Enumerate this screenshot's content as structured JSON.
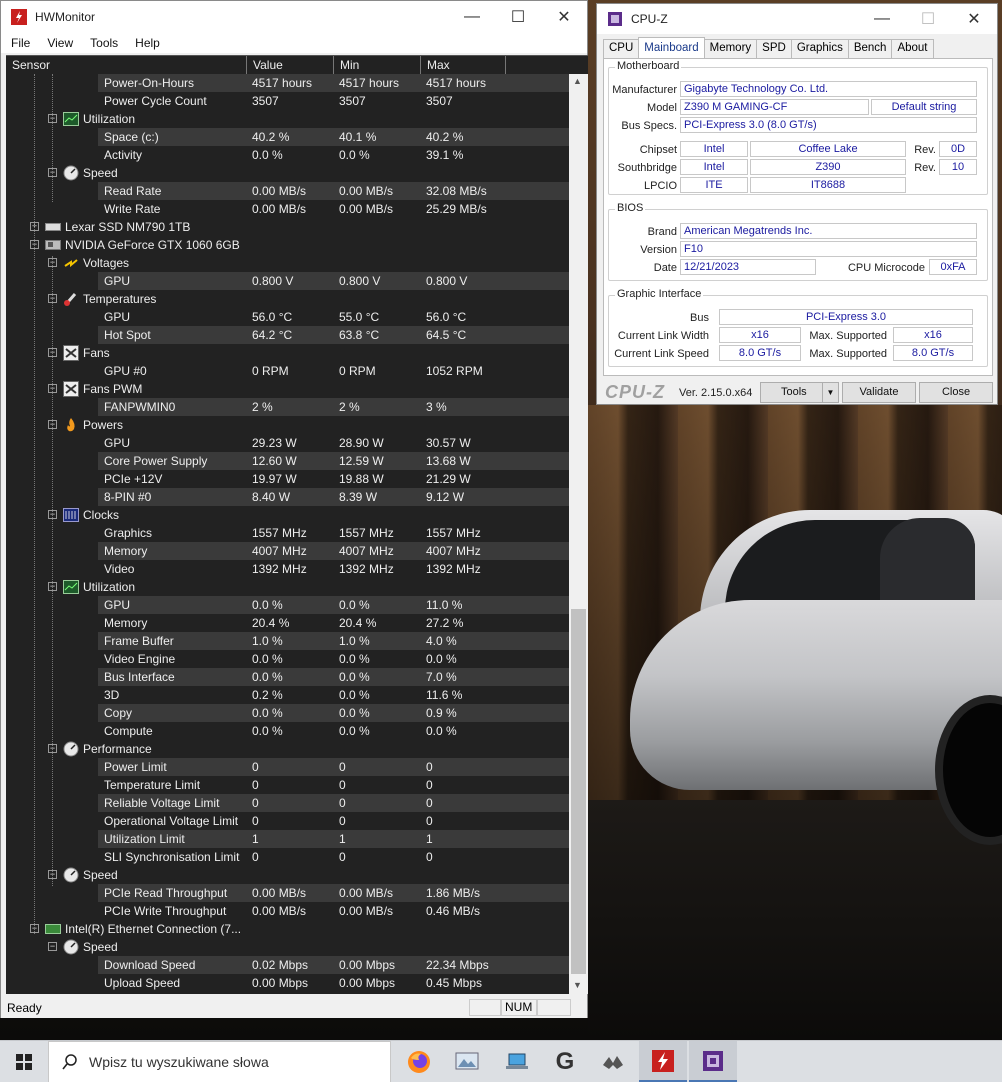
{
  "hwmonitor": {
    "title": "HWMonitor",
    "menu": [
      "File",
      "View",
      "Tools",
      "Help"
    ],
    "columns": [
      "Sensor",
      "Value",
      "Min",
      "Max"
    ],
    "status": "Ready",
    "status_num": "NUM",
    "devices": {
      "lexar": "Lexar SSD NM790 1TB",
      "nvidia": "NVIDIA GeForce GTX 1060 6GB",
      "intel": "Intel(R) Ethernet Connection (7..."
    },
    "groups": {
      "util1": "Utilization",
      "speed1": "Speed",
      "voltages": "Voltages",
      "temps": "Temperatures",
      "fans": "Fans",
      "fanspwm": "Fans PWM",
      "powers": "Powers",
      "clocks": "Clocks",
      "util2": "Utilization",
      "perf": "Performance",
      "speed2": "Speed",
      "speed3": "Speed"
    },
    "rows": [
      [
        "Power-On-Hours",
        "4517 hours",
        "4517 hours",
        "4517 hours"
      ],
      [
        "Power Cycle Count",
        "3507",
        "3507",
        "3507"
      ],
      [
        "Space (c:)",
        "40.2 %",
        "40.1 %",
        "40.2 %"
      ],
      [
        "Activity",
        "0.0 %",
        "0.0 %",
        "39.1 %"
      ],
      [
        "Read Rate",
        "0.00 MB/s",
        "0.00 MB/s",
        "32.08 MB/s"
      ],
      [
        "Write Rate",
        "0.00 MB/s",
        "0.00 MB/s",
        "25.29 MB/s"
      ],
      [
        "GPU",
        "0.800 V",
        "0.800 V",
        "0.800 V"
      ],
      [
        "GPU",
        "56.0 °C",
        "55.0 °C",
        "56.0 °C"
      ],
      [
        "Hot Spot",
        "64.2 °C",
        "63.8 °C",
        "64.5 °C"
      ],
      [
        "GPU #0",
        "0 RPM",
        "0 RPM",
        "1052 RPM"
      ],
      [
        "FANPWMIN0",
        "2 %",
        "2 %",
        "3 %"
      ],
      [
        "GPU",
        "29.23 W",
        "28.90 W",
        "30.57 W"
      ],
      [
        "Core Power Supply",
        "12.60 W",
        "12.59 W",
        "13.68 W"
      ],
      [
        "PCIe +12V",
        "19.97 W",
        "19.88 W",
        "21.29 W"
      ],
      [
        "8-PIN #0",
        "8.40 W",
        "8.39 W",
        "9.12 W"
      ],
      [
        "Graphics",
        "1557 MHz",
        "1557 MHz",
        "1557 MHz"
      ],
      [
        "Memory",
        "4007 MHz",
        "4007 MHz",
        "4007 MHz"
      ],
      [
        "Video",
        "1392 MHz",
        "1392 MHz",
        "1392 MHz"
      ],
      [
        "GPU",
        "0.0 %",
        "0.0 %",
        "11.0 %"
      ],
      [
        "Memory",
        "20.4 %",
        "20.4 %",
        "27.2 %"
      ],
      [
        "Frame Buffer",
        "1.0 %",
        "1.0 %",
        "4.0 %"
      ],
      [
        "Video Engine",
        "0.0 %",
        "0.0 %",
        "0.0 %"
      ],
      [
        "Bus Interface",
        "0.0 %",
        "0.0 %",
        "7.0 %"
      ],
      [
        "3D",
        "0.2 %",
        "0.0 %",
        "11.6 %"
      ],
      [
        "Copy",
        "0.0 %",
        "0.0 %",
        "0.9 %"
      ],
      [
        "Compute",
        "0.0 %",
        "0.0 %",
        "0.0 %"
      ],
      [
        "Power Limit",
        "0",
        "0",
        "0"
      ],
      [
        "Temperature Limit",
        "0",
        "0",
        "0"
      ],
      [
        "Reliable Voltage Limit",
        "0",
        "0",
        "0"
      ],
      [
        "Operational Voltage Limit",
        "0",
        "0",
        "0"
      ],
      [
        "Utilization Limit",
        "1",
        "1",
        "1"
      ],
      [
        "SLI Synchronisation Limit",
        "0",
        "0",
        "0"
      ],
      [
        "PCIe Read Throughput",
        "0.00 MB/s",
        "0.00 MB/s",
        "1.86 MB/s"
      ],
      [
        "PCIe Write Throughput",
        "0.00 MB/s",
        "0.00 MB/s",
        "0.46 MB/s"
      ],
      [
        "Download Speed",
        "0.02 Mbps",
        "0.00 Mbps",
        "22.34 Mbps"
      ],
      [
        "Upload Speed",
        "0.00 Mbps",
        "0.00 Mbps",
        "0.45 Mbps"
      ]
    ]
  },
  "cpuz": {
    "title": "CPU-Z",
    "tabs": [
      "CPU",
      "Mainboard",
      "Memory",
      "SPD",
      "Graphics",
      "Bench",
      "About"
    ],
    "motherboard": {
      "legend": "Motherboard",
      "manufacturer_label": "Manufacturer",
      "manufacturer": "Gigabyte Technology Co. Ltd.",
      "model_label": "Model",
      "model": "Z390 M GAMING-CF",
      "model_extra": "Default string",
      "busspecs_label": "Bus Specs.",
      "busspecs": "PCI-Express 3.0 (8.0 GT/s)",
      "chipset_label": "Chipset",
      "chipset_vendor": "Intel",
      "chipset_name": "Coffee Lake",
      "chipset_rev_label": "Rev.",
      "chipset_rev": "0D",
      "southbridge_label": "Southbridge",
      "sb_vendor": "Intel",
      "sb_name": "Z390",
      "sb_rev_label": "Rev.",
      "sb_rev": "10",
      "lpcio_label": "LPCIO",
      "lpcio_vendor": "ITE",
      "lpcio_name": "IT8688"
    },
    "bios": {
      "legend": "BIOS",
      "brand_label": "Brand",
      "brand": "American Megatrends Inc.",
      "version_label": "Version",
      "version": "F10",
      "date_label": "Date",
      "date": "12/21/2023",
      "microcode_label": "CPU Microcode",
      "microcode": "0xFA"
    },
    "graphic": {
      "legend": "Graphic Interface",
      "bus_label": "Bus",
      "bus": "PCI-Express 3.0",
      "lw_label": "Current Link Width",
      "lw": "x16",
      "ms1_label": "Max. Supported",
      "ms1": "x16",
      "ls_label": "Current Link Speed",
      "ls": "8.0 GT/s",
      "ms2_label": "Max. Supported",
      "ms2": "8.0 GT/s"
    },
    "logo": "CPU-Z",
    "version": "Ver. 2.15.0.x64",
    "tools": "Tools",
    "validate": "Validate",
    "close": "Close"
  },
  "taskbar": {
    "search_placeholder": "Wpisz tu wyszukiwane słowa",
    "apps": [
      "firefox-icon",
      "photos-icon",
      "laptop-icon",
      "g-app-icon",
      "bird-app-icon",
      "hwmonitor-icon",
      "cpuz-icon"
    ]
  }
}
